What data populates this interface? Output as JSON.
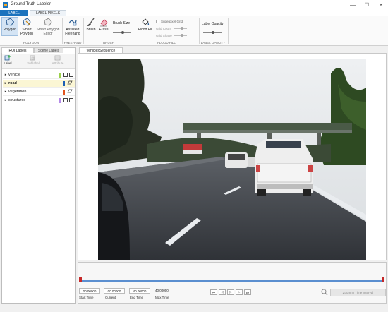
{
  "window": {
    "title": "Ground Truth Labeler",
    "minimize": "—",
    "maximize": "☐",
    "close": "✕"
  },
  "ribbon": {
    "tabs": [
      "LABEL",
      "LABEL PIXELS"
    ],
    "buttons": {
      "polygon": [
        "Polygon"
      ],
      "smart_polygon": [
        "Smart",
        "Polygon"
      ],
      "smart_polygon_editor": [
        "Smart Polygon",
        "Editor"
      ],
      "assisted_freehand": [
        "Assisted",
        "Freehand"
      ],
      "brush": "Brush",
      "erase": "Erase",
      "brush_size": "Brush Size",
      "flood_fill": "Flood Fill",
      "superpixel_grid": "Superpixel Grid",
      "grid_count": "Grid Count",
      "grid_shape": "Grid Shape",
      "label_opacity": "Label Opacity"
    },
    "sections": {
      "polygon": "POLYGON",
      "freehand": "FREEHAND",
      "brush": "BRUSH",
      "flood_fill": "FLOOD FILL",
      "label_opacity": "LABEL OPACITY"
    },
    "brush_size_level": 0.55,
    "label_opacity_level": 0.55
  },
  "left_panel": {
    "tabs": [
      "ROI Labels",
      "Scene Labels"
    ],
    "toolbar": {
      "label": "Label",
      "sublabel": "Sublabel",
      "attribute": "Attribute"
    },
    "labels": [
      {
        "name": "vehicle",
        "color": "#9bd14b",
        "selected": false
      },
      {
        "name": "road",
        "color": "#1c5fb5",
        "selected": true
      },
      {
        "name": "vegetation",
        "color": "#e2541f",
        "selected": false
      },
      {
        "name": "structures",
        "color": "#b48ae8",
        "selected": false
      }
    ]
  },
  "document": {
    "tab": "vehiclesSequence"
  },
  "timeline": {
    "start_time": "00.00000",
    "current": "00.00000",
    "end_time": "40.00000",
    "max_time": "40.00000",
    "labels": {
      "start": "Start Time",
      "current": "Current",
      "end": "End Time",
      "max": "Max Time"
    },
    "zoom_button": "Zoom In Time Interval",
    "progress": 0.0
  },
  "colors": {
    "accent": "#1c73bd",
    "selected_row": "#fbf6d4"
  }
}
